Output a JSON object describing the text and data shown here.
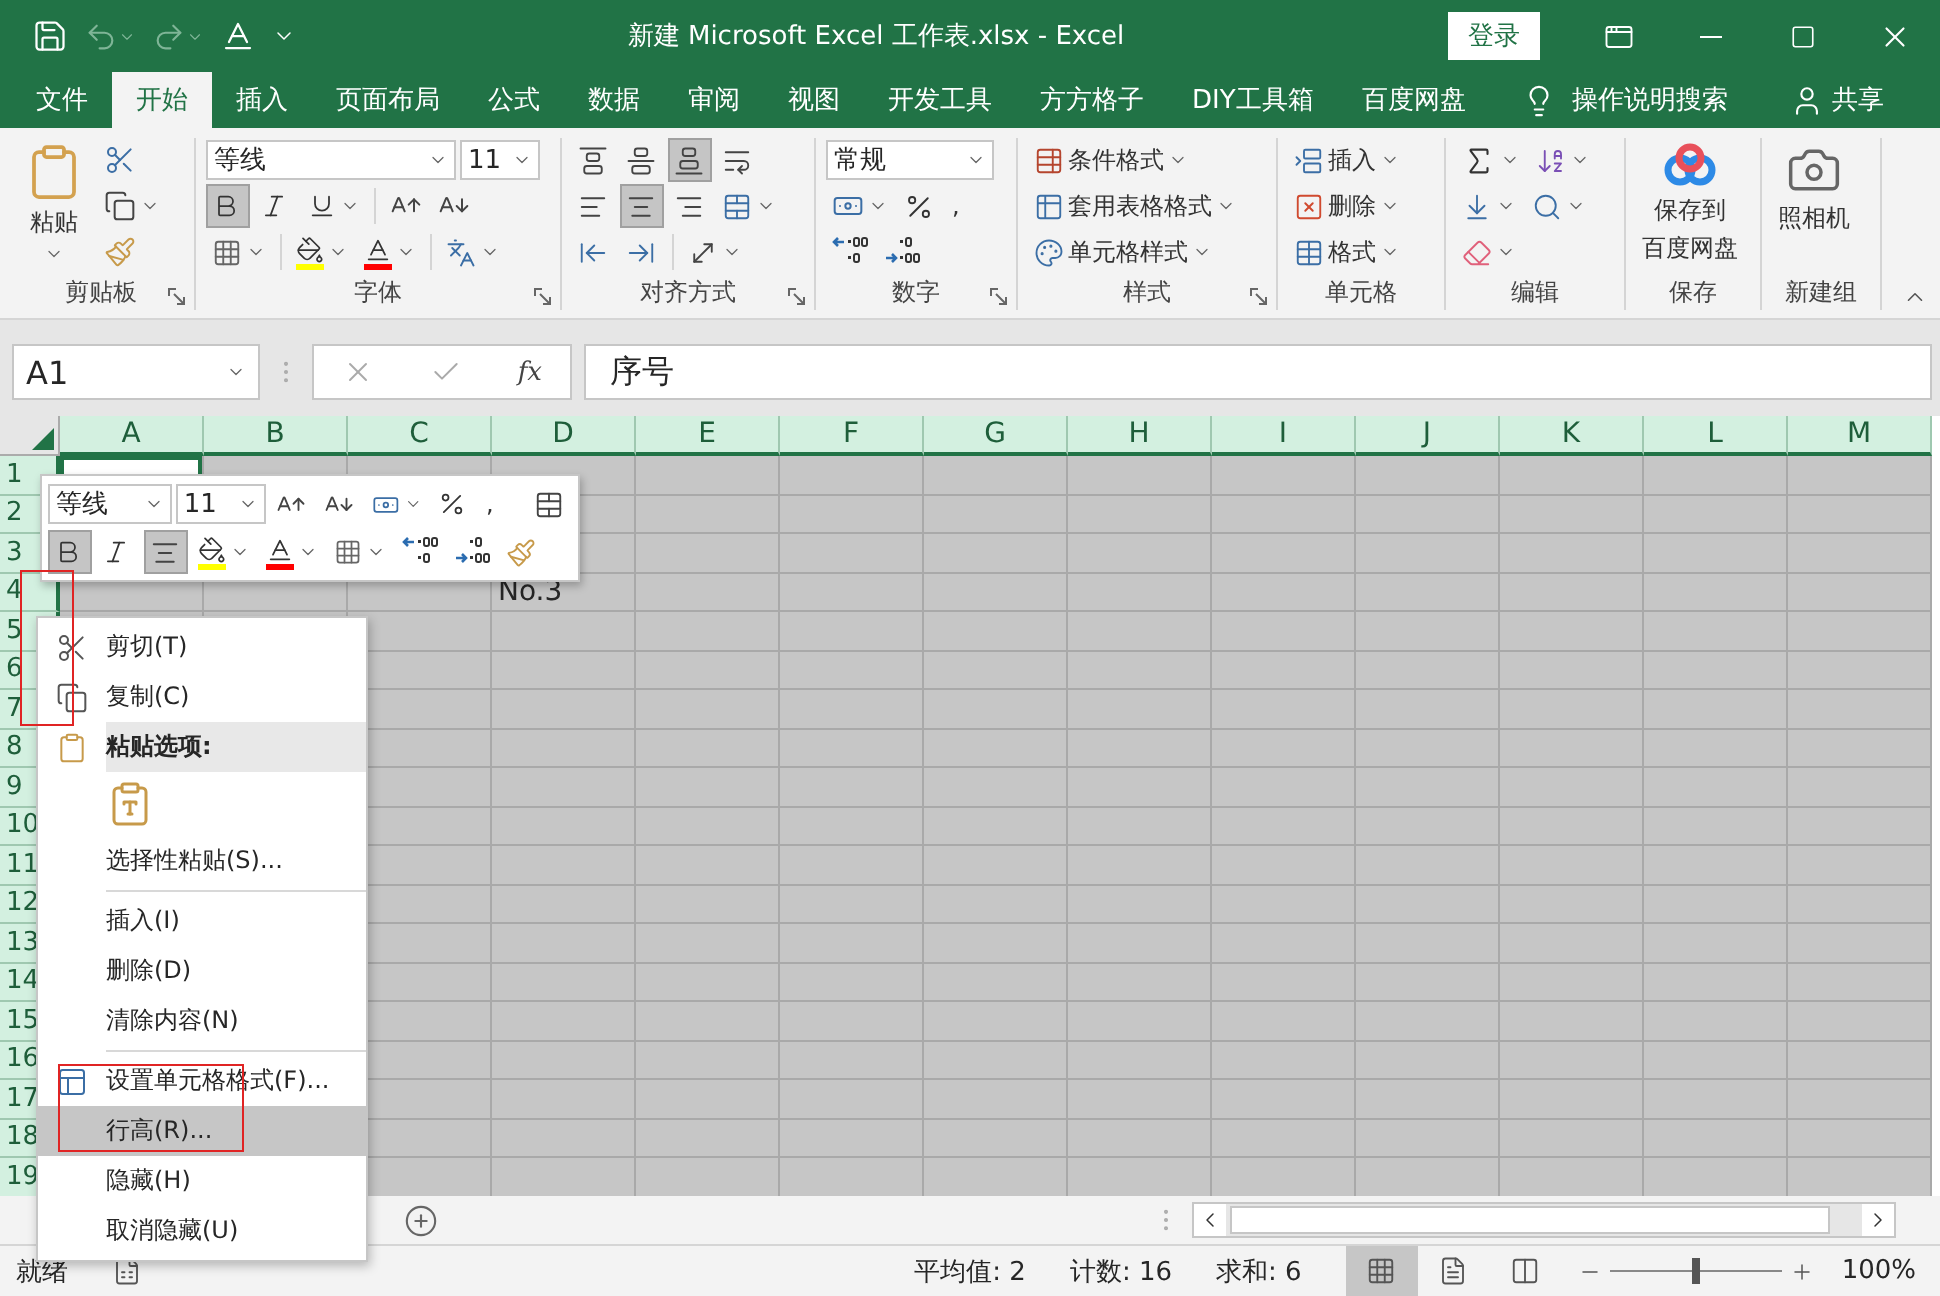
{
  "window": {
    "title": "新建 Microsoft Excel 工作表.xlsx  -  Excel",
    "login_button": "登录",
    "undo_disabled": true,
    "redo_disabled": true
  },
  "ribbon_tabs": [
    {
      "label": "文件",
      "selected": false
    },
    {
      "label": "开始",
      "selected": true
    },
    {
      "label": "插入",
      "selected": false
    },
    {
      "label": "页面布局",
      "selected": false
    },
    {
      "label": "公式",
      "selected": false
    },
    {
      "label": "数据",
      "selected": false
    },
    {
      "label": "审阅",
      "selected": false
    },
    {
      "label": "视图",
      "selected": false
    },
    {
      "label": "开发工具",
      "selected": false
    },
    {
      "label": "方方格子",
      "selected": false
    },
    {
      "label": "DIY工具箱",
      "selected": false
    },
    {
      "label": "百度网盘",
      "selected": false
    }
  ],
  "tell_me": "操作说明搜索",
  "share": "共享",
  "ribbon": {
    "clipboard": {
      "label": "剪贴板",
      "paste": "粘贴"
    },
    "font": {
      "label": "字体",
      "font_name": "等线",
      "font_size": "11",
      "bold": true,
      "italic": false,
      "underline": false
    },
    "alignment": {
      "label": "对齐方式",
      "top": false,
      "middle": false,
      "bottom": true,
      "left": false,
      "center": true,
      "right": false
    },
    "number": {
      "label": "数字",
      "format": "常规",
      "comma": ","
    },
    "styles": {
      "label": "样式",
      "buttons": [
        "条件格式",
        "套用表格格式",
        "单元格样式"
      ]
    },
    "cells": {
      "label": "单元格",
      "buttons": [
        "插入",
        "删除",
        "格式"
      ]
    },
    "editing": {
      "label": "编辑"
    },
    "baidu": {
      "label": "保存",
      "button_lines": [
        "保存到",
        "百度网盘"
      ]
    },
    "new_group": {
      "label": "新建组",
      "button": "照相机"
    }
  },
  "formula_bar": {
    "name_box": "A1",
    "fx": "fx",
    "formula": "序号"
  },
  "sheet": {
    "columns": [
      "A",
      "B",
      "C",
      "D",
      "E",
      "F",
      "G",
      "H",
      "I",
      "J",
      "K",
      "L",
      "M"
    ],
    "rows": [
      {
        "header": "1"
      },
      {
        "header": "2"
      },
      {
        "header": "3"
      },
      {
        "header": "4",
        "cells": [
          null,
          null,
          null,
          "No.3"
        ]
      },
      {
        "header": "5"
      },
      {
        "header": "6"
      },
      {
        "header": "7"
      },
      {
        "header": "8"
      },
      {
        "header": "9"
      },
      {
        "header": "10"
      },
      {
        "header": "11"
      },
      {
        "header": "12"
      },
      {
        "header": "13"
      },
      {
        "header": "14"
      },
      {
        "header": "15"
      },
      {
        "header": "16"
      },
      {
        "header": "17"
      },
      {
        "header": "18"
      },
      {
        "header": "19"
      }
    ]
  },
  "mini_toolbar": {
    "font_name": "等线",
    "font_size": "11",
    "comma": ",",
    "bold": true,
    "italic": false,
    "center": true
  },
  "context_menu": [
    {
      "kind": "cut",
      "label": "剪切(T)",
      "selected": false
    },
    {
      "kind": "copy",
      "label": "复制(C)",
      "selected": false
    },
    {
      "kind": "paste-header",
      "label": "粘贴选项:",
      "selected": false
    },
    {
      "kind": "paste-option",
      "selected": false
    },
    {
      "kind": "command",
      "label": "选择性粘贴(S)...",
      "selected": false
    },
    {
      "kind": "command",
      "label": "插入(I)",
      "selected": false,
      "divider_above": true
    },
    {
      "kind": "command",
      "label": "删除(D)",
      "selected": false
    },
    {
      "kind": "command",
      "label": "清除内容(N)",
      "selected": false
    },
    {
      "kind": "format-cells",
      "label": "设置单元格格式(F)...",
      "selected": false,
      "divider_above": true
    },
    {
      "kind": "command",
      "label": "行高(R)...",
      "selected": true
    },
    {
      "kind": "command",
      "label": "隐藏(H)",
      "selected": false
    },
    {
      "kind": "command",
      "label": "取消隐藏(U)",
      "selected": false
    }
  ],
  "status_bar": {
    "mode": "就绪",
    "stats": [
      "平均值: 2",
      "计数: 16",
      "求和: 6"
    ],
    "views": [
      {
        "selected": true
      },
      {
        "selected": false
      },
      {
        "selected": false
      }
    ],
    "zoom": {
      "level": 0.5,
      "label": "100%"
    }
  }
}
